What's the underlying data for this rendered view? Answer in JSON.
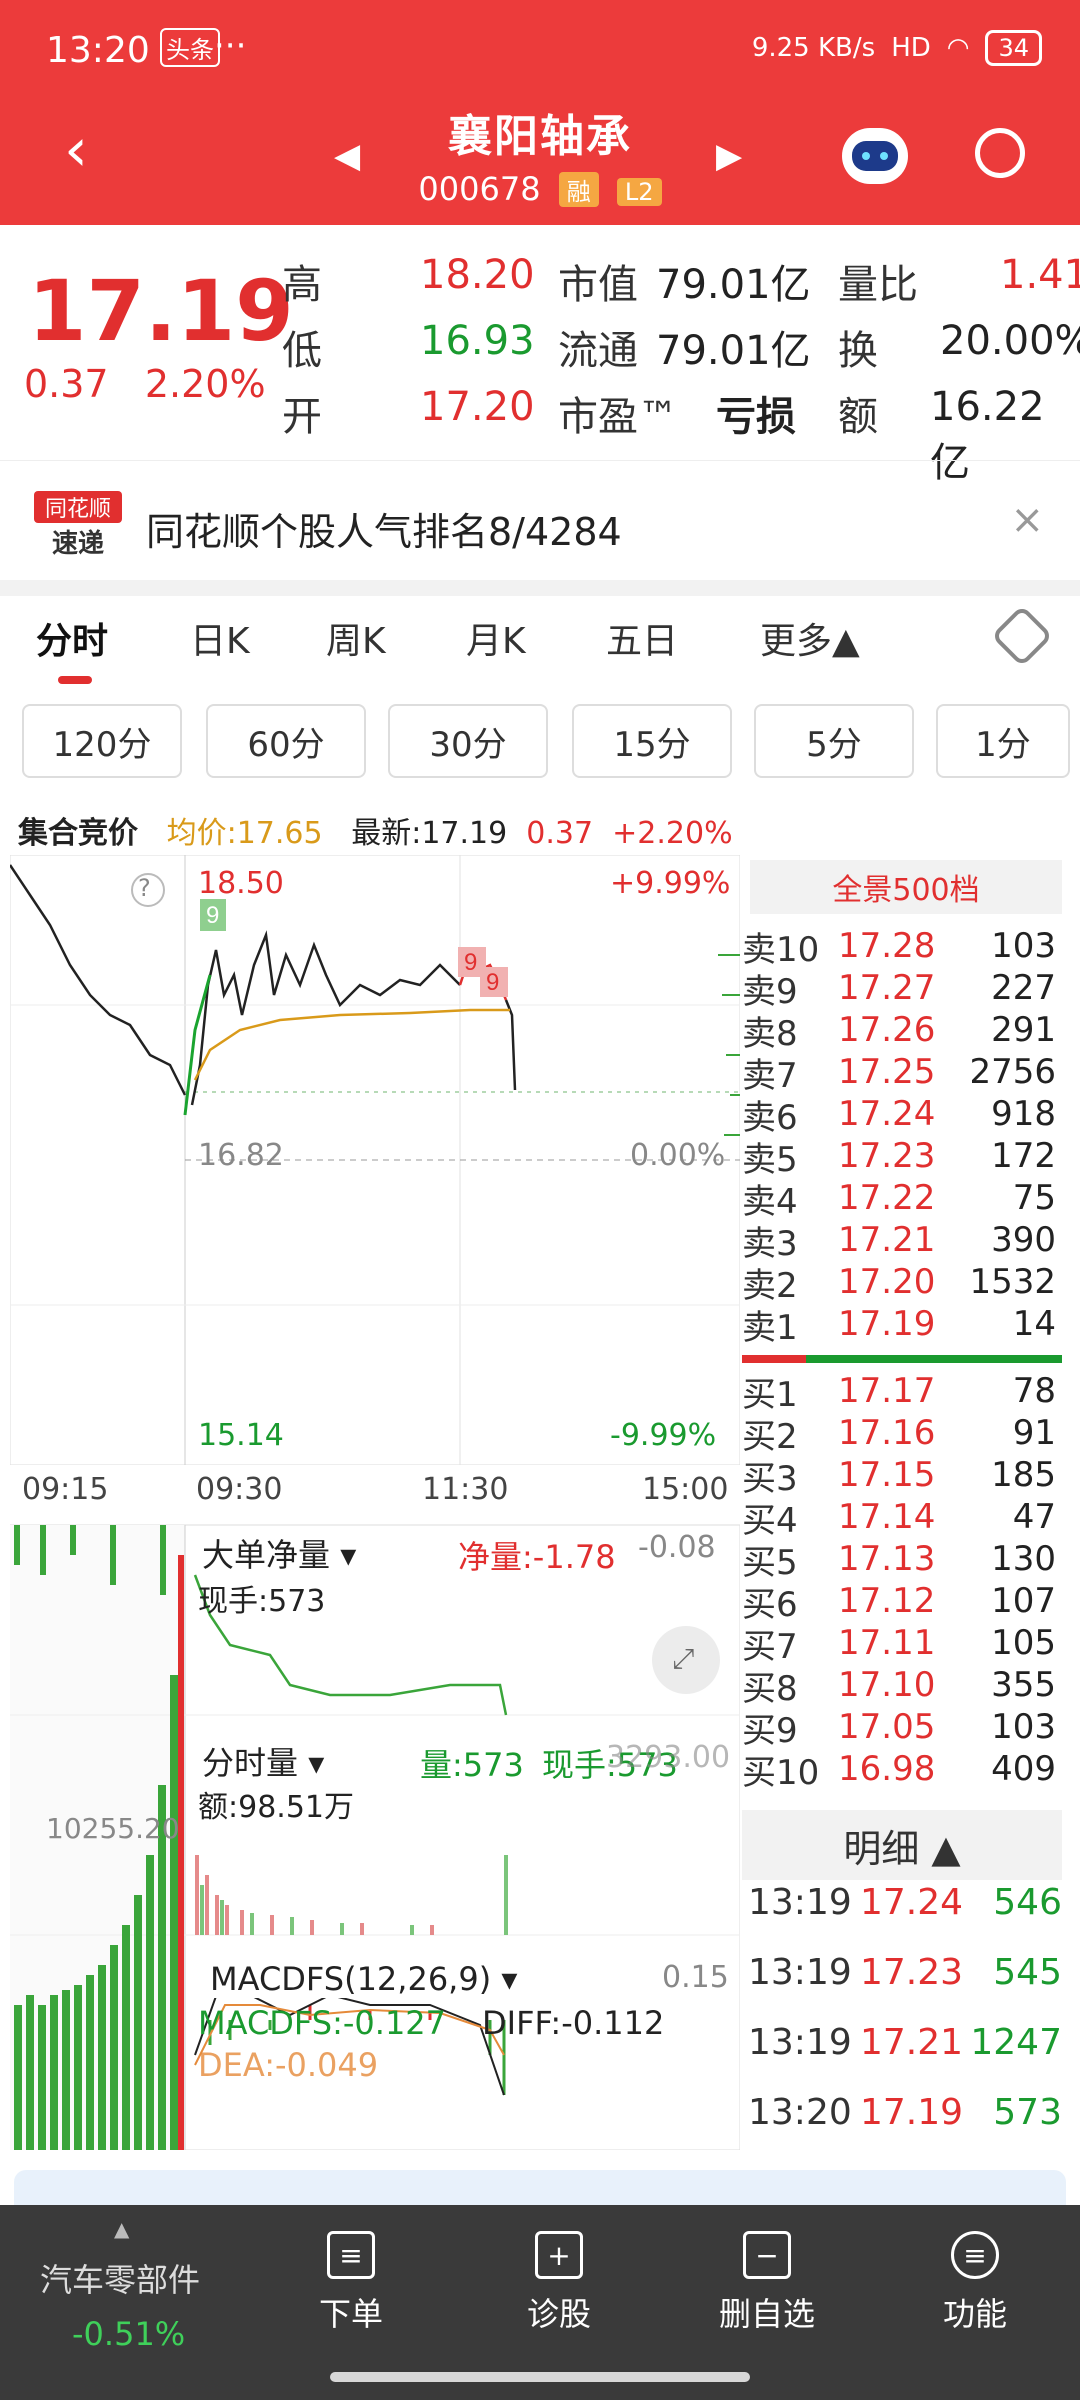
{
  "status_bar": {
    "time": "13:20",
    "news_tag": "头条",
    "more": "···",
    "net_speed": "9.25 KB/s",
    "network": "HD",
    "battery": "34"
  },
  "header": {
    "title": "襄阳轴承",
    "code": "000678",
    "tag_margin": "融",
    "tag_level": "L2"
  },
  "quote": {
    "price": "17.19",
    "change": "0.37",
    "change_pct": "2.20%",
    "high_label": "高",
    "high": "18.20",
    "low_label": "低",
    "low": "16.93",
    "open_label": "开",
    "open": "17.20",
    "mktcap_label": "市值",
    "mktcap": "79.01亿",
    "float_label": "流通",
    "float": "79.01亿",
    "pe_label": "市盈™",
    "pe": "亏损",
    "vol_ratio_label": "量比",
    "vol_ratio": "1.41",
    "turnover_label": "换",
    "turnover": "20.00%",
    "amount_label": "额",
    "amount": "16.22亿"
  },
  "banner": {
    "logo_line1": "同花顺",
    "logo_line2": "速递",
    "text": "同花顺个股人气排名8/4284",
    "close": "×"
  },
  "tabs": [
    "分时",
    "日K",
    "周K",
    "月K",
    "五日",
    "更多▲"
  ],
  "periods": [
    "120分",
    "60分",
    "30分",
    "15分",
    "5分",
    "1分"
  ],
  "chart_info": {
    "auction": "集合竞价",
    "avg": "均价:17.65",
    "latest": "最新:17.19",
    "chg": "0.37",
    "chg_pct": "+2.20%"
  },
  "chart_labels": {
    "top_price": "18.50",
    "top_pct": "+9.99%",
    "mid_price": "16.82",
    "mid_pct": "0.00%",
    "bot_price": "15.14",
    "bot_pct": "-9.99%",
    "t1": "09:15",
    "t2": "09:30",
    "t3": "11:30",
    "t4": "15:00",
    "help": "?"
  },
  "big_order": {
    "title": "大单净量",
    "net": "净量:-1.78",
    "cur": "现手:573",
    "right": "-0.08"
  },
  "vol_panel": {
    "title": "分时量",
    "vol": "量:573",
    "cur": "现手:573",
    "right": "3293.00",
    "amount": "额:98.51万",
    "left_val": "10255.20"
  },
  "macd_panel": {
    "title": "MACDFS(12,26,9)",
    "macd": "MACDFS:-0.127",
    "diff": "DIFF:-0.112",
    "dea": "DEA:-0.049",
    "right": "0.15"
  },
  "book_title": "全景500档",
  "asks": [
    {
      "label": "卖10",
      "price": "17.28",
      "vol": "103"
    },
    {
      "label": "卖9",
      "price": "17.27",
      "vol": "227"
    },
    {
      "label": "卖8",
      "price": "17.26",
      "vol": "291"
    },
    {
      "label": "卖7",
      "price": "17.25",
      "vol": "2756"
    },
    {
      "label": "卖6",
      "price": "17.24",
      "vol": "918"
    },
    {
      "label": "卖5",
      "price": "17.23",
      "vol": "172"
    },
    {
      "label": "卖4",
      "price": "17.22",
      "vol": "75"
    },
    {
      "label": "卖3",
      "price": "17.21",
      "vol": "390"
    },
    {
      "label": "卖2",
      "price": "17.20",
      "vol": "1532"
    },
    {
      "label": "卖1",
      "price": "17.19",
      "vol": "14"
    }
  ],
  "bids": [
    {
      "label": "买1",
      "price": "17.17",
      "vol": "78"
    },
    {
      "label": "买2",
      "price": "17.16",
      "vol": "91"
    },
    {
      "label": "买3",
      "price": "17.15",
      "vol": "185"
    },
    {
      "label": "买4",
      "price": "17.14",
      "vol": "47"
    },
    {
      "label": "买5",
      "price": "17.13",
      "vol": "130"
    },
    {
      "label": "买6",
      "price": "17.12",
      "vol": "107"
    },
    {
      "label": "买7",
      "price": "17.11",
      "vol": "105"
    },
    {
      "label": "买8",
      "price": "17.10",
      "vol": "355"
    },
    {
      "label": "买9",
      "price": "17.05",
      "vol": "103"
    },
    {
      "label": "买10",
      "price": "16.98",
      "vol": "409"
    }
  ],
  "detail": {
    "title": "明细 ▲"
  },
  "deals": [
    {
      "time": "13:19",
      "price": "17.24",
      "vol": "546"
    },
    {
      "time": "13:19",
      "price": "17.23",
      "vol": "545"
    },
    {
      "time": "13:19",
      "price": "17.21",
      "vol": "1247"
    },
    {
      "time": "13:20",
      "price": "17.19",
      "vol": "573"
    }
  ],
  "bottom_nav": {
    "sector": "汽车零部件",
    "sector_chg": "-0.51%",
    "items": [
      "下单",
      "诊股",
      "删自选",
      "功能"
    ]
  },
  "colors": {
    "header": "#ec3b3b",
    "up": "#e12f2f",
    "down": "#1a9a2f",
    "avg": "#d99a1a"
  }
}
